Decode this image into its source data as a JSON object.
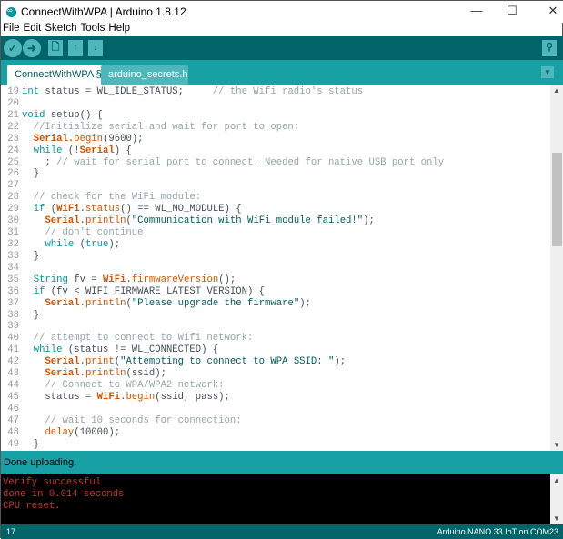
{
  "window": {
    "title": "ConnectWithWPA | Arduino 1.8.12",
    "minimize": "—",
    "maximize": "☐",
    "close": "✕"
  },
  "menu": [
    "File",
    "Edit",
    "Sketch",
    "Tools",
    "Help"
  ],
  "toolbar": {
    "verify": "✓",
    "upload": "➜",
    "new": "🗋",
    "open": "↑",
    "save": "↓",
    "serial_monitor": "⚲"
  },
  "tabs": [
    {
      "label": "ConnectWithWPA §",
      "active": true
    },
    {
      "label": "arduino_secrets.h",
      "active": false
    }
  ],
  "editor": {
    "lines": [
      {
        "n": "19",
        "t": [
          [
            "int",
            "kw"
          ],
          [
            " status = WL_IDLE_STATUS;     ",
            "tx"
          ],
          [
            "// the Wifi radio's status",
            "cm"
          ]
        ]
      },
      {
        "n": "20",
        "t": []
      },
      {
        "n": "21",
        "t": [
          [
            "void",
            "kw"
          ],
          [
            " setup() {",
            "tx"
          ]
        ]
      },
      {
        "n": "22",
        "t": [
          [
            "  //Initialize serial and wait for port to open:",
            "cm"
          ]
        ]
      },
      {
        "n": "23",
        "t": [
          [
            "  ",
            "tx"
          ],
          [
            "Serial",
            "obj"
          ],
          [
            ".",
            "tx"
          ],
          [
            "begin",
            "fn"
          ],
          [
            "(9600);",
            "tx"
          ]
        ]
      },
      {
        "n": "24",
        "t": [
          [
            "  ",
            "tx"
          ],
          [
            "while",
            "kw"
          ],
          [
            " (!",
            "tx"
          ],
          [
            "Serial",
            "obj"
          ],
          [
            ") {",
            "tx"
          ]
        ]
      },
      {
        "n": "25",
        "t": [
          [
            "    ; ",
            "tx"
          ],
          [
            "// wait for serial port to connect. Needed for native USB port only",
            "cm"
          ]
        ]
      },
      {
        "n": "26",
        "t": [
          [
            "  }",
            "tx"
          ]
        ]
      },
      {
        "n": "27",
        "t": []
      },
      {
        "n": "28",
        "t": [
          [
            "  // check for the WiFi module:",
            "cm"
          ]
        ]
      },
      {
        "n": "29",
        "t": [
          [
            "  ",
            "tx"
          ],
          [
            "if",
            "kw"
          ],
          [
            " (",
            "tx"
          ],
          [
            "WiFi",
            "obj"
          ],
          [
            ".",
            "tx"
          ],
          [
            "status",
            "fn"
          ],
          [
            "() == WL_NO_MODULE) {",
            "tx"
          ]
        ]
      },
      {
        "n": "30",
        "t": [
          [
            "    ",
            "tx"
          ],
          [
            "Serial",
            "obj"
          ],
          [
            ".",
            "tx"
          ],
          [
            "println",
            "fn"
          ],
          [
            "(",
            "tx"
          ],
          [
            "\"Communication with WiFi module failed!\"",
            "str"
          ],
          [
            ");",
            "tx"
          ]
        ]
      },
      {
        "n": "31",
        "t": [
          [
            "    // don't continue",
            "cm"
          ]
        ]
      },
      {
        "n": "32",
        "t": [
          [
            "    ",
            "tx"
          ],
          [
            "while",
            "kw"
          ],
          [
            " (",
            "tx"
          ],
          [
            "true",
            "kw"
          ],
          [
            ");",
            "tx"
          ]
        ]
      },
      {
        "n": "33",
        "t": [
          [
            "  }",
            "tx"
          ]
        ]
      },
      {
        "n": "34",
        "t": []
      },
      {
        "n": "35",
        "t": [
          [
            "  ",
            "tx"
          ],
          [
            "String",
            "kw"
          ],
          [
            " fv = ",
            "tx"
          ],
          [
            "WiFi",
            "obj"
          ],
          [
            ".",
            "tx"
          ],
          [
            "firmwareVersion",
            "fn"
          ],
          [
            "();",
            "tx"
          ]
        ]
      },
      {
        "n": "36",
        "t": [
          [
            "  ",
            "tx"
          ],
          [
            "if",
            "kw"
          ],
          [
            " (fv < WIFI_FIRMWARE_LATEST_VERSION) {",
            "tx"
          ]
        ]
      },
      {
        "n": "37",
        "t": [
          [
            "    ",
            "tx"
          ],
          [
            "Serial",
            "obj"
          ],
          [
            ".",
            "tx"
          ],
          [
            "println",
            "fn"
          ],
          [
            "(",
            "tx"
          ],
          [
            "\"Please upgrade the firmware\"",
            "str"
          ],
          [
            ");",
            "tx"
          ]
        ]
      },
      {
        "n": "38",
        "t": [
          [
            "  }",
            "tx"
          ]
        ]
      },
      {
        "n": "39",
        "t": []
      },
      {
        "n": "40",
        "t": [
          [
            "  // attempt to connect to Wifi network:",
            "cm"
          ]
        ]
      },
      {
        "n": "41",
        "t": [
          [
            "  ",
            "tx"
          ],
          [
            "while",
            "kw"
          ],
          [
            " (status != WL_CONNECTED) {",
            "tx"
          ]
        ]
      },
      {
        "n": "42",
        "t": [
          [
            "    ",
            "tx"
          ],
          [
            "Serial",
            "obj"
          ],
          [
            ".",
            "tx"
          ],
          [
            "print",
            "fn"
          ],
          [
            "(",
            "tx"
          ],
          [
            "\"Attempting to connect to WPA SSID: \"",
            "str"
          ],
          [
            ");",
            "tx"
          ]
        ]
      },
      {
        "n": "43",
        "t": [
          [
            "    ",
            "tx"
          ],
          [
            "Serial",
            "obj"
          ],
          [
            ".",
            "tx"
          ],
          [
            "println",
            "fn"
          ],
          [
            "(ssid);",
            "tx"
          ]
        ]
      },
      {
        "n": "44",
        "t": [
          [
            "    // Connect to WPA/WPA2 network:",
            "cm"
          ]
        ]
      },
      {
        "n": "45",
        "t": [
          [
            "    status = ",
            "tx"
          ],
          [
            "WiFi",
            "obj"
          ],
          [
            ".",
            "tx"
          ],
          [
            "begin",
            "fn"
          ],
          [
            "(ssid, pass);",
            "tx"
          ]
        ]
      },
      {
        "n": "46",
        "t": []
      },
      {
        "n": "47",
        "t": [
          [
            "    // wait 10 seconds for connection:",
            "cm"
          ]
        ]
      },
      {
        "n": "48",
        "t": [
          [
            "    ",
            "tx"
          ],
          [
            "delay",
            "fn"
          ],
          [
            "(10000);",
            "tx"
          ]
        ]
      },
      {
        "n": "49",
        "t": [
          [
            "  }",
            "tx"
          ]
        ]
      }
    ]
  },
  "status": {
    "message": "Done uploading."
  },
  "console": {
    "lines": [
      "Verify successful",
      "done in 0.014 seconds",
      "CPU reset."
    ]
  },
  "bottom": {
    "line_number": "17",
    "board": "Arduino NANO 33 IoT on COM23"
  },
  "colors": {
    "toolbar": "#006468",
    "tabbar": "#17a1a5",
    "keyword": "#00979c",
    "object": "#d35400",
    "comment": "#95a5a6",
    "console_text": "#c0392b"
  }
}
